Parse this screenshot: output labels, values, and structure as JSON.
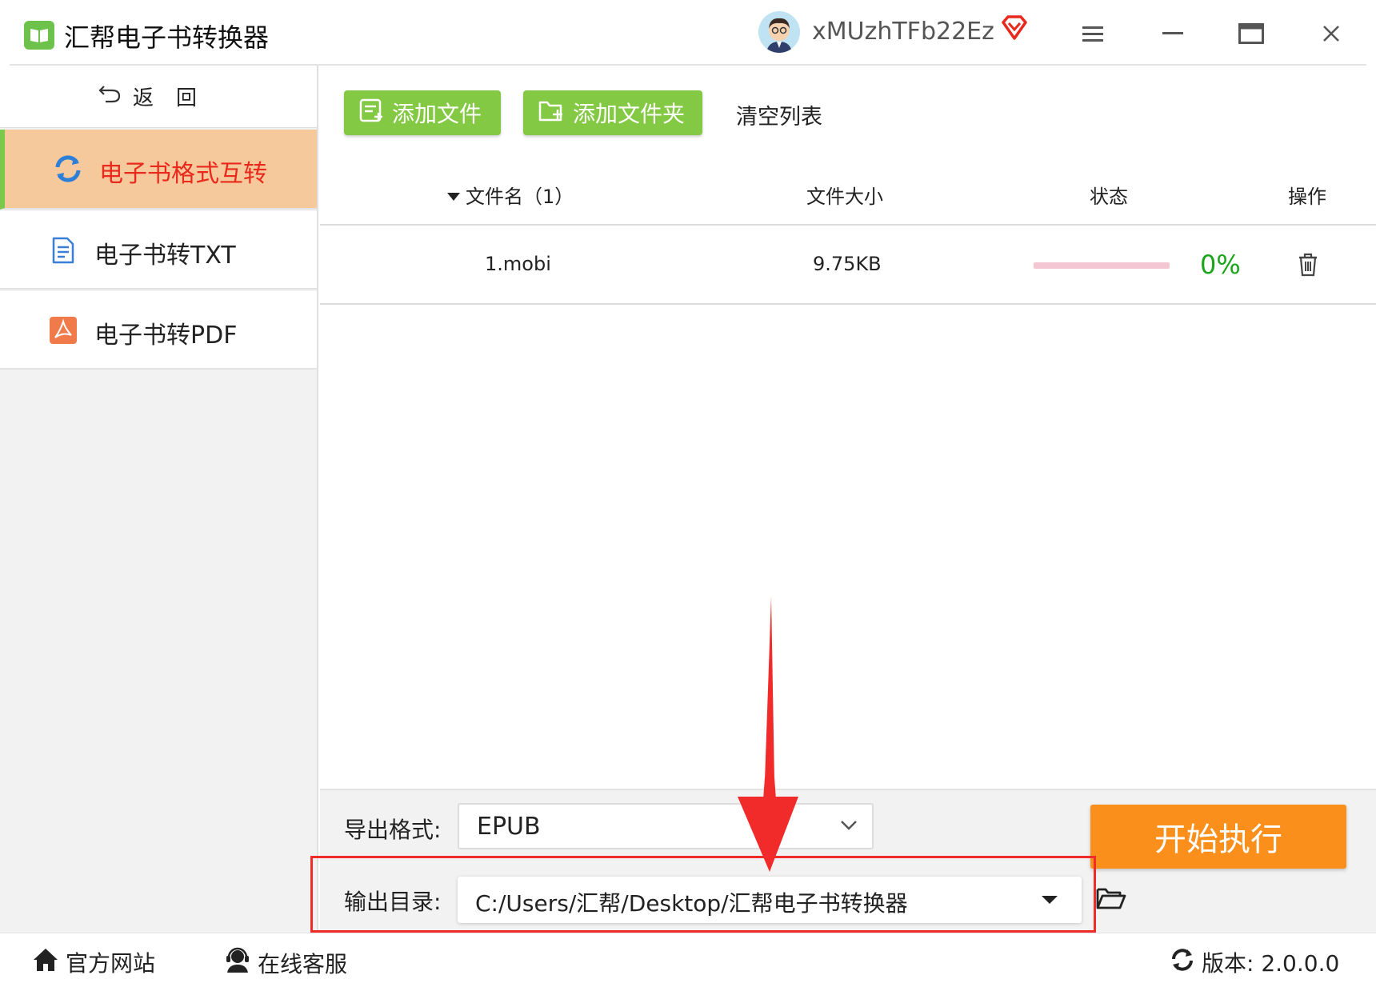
{
  "app": {
    "title": "汇帮电子书转换器",
    "username": "xMUzhTFb22Ez"
  },
  "sidebar": {
    "back_label": "返回",
    "items": [
      {
        "label": "电子书格式互转",
        "icon": "refresh-icon",
        "active": true
      },
      {
        "label": "电子书转TXT",
        "icon": "document-icon",
        "active": false
      },
      {
        "label": "电子书转PDF",
        "icon": "pdf-icon",
        "active": false
      }
    ]
  },
  "toolbar": {
    "add_file": "添加文件",
    "add_folder": "添加文件夹",
    "clear_list": "清空列表"
  },
  "table": {
    "headers": {
      "filename": "文件名（1）",
      "size": "文件大小",
      "status": "状态",
      "action": "操作"
    },
    "rows": [
      {
        "filename": "1.mobi",
        "size": "9.75KB",
        "progress": "0%",
        "progress_value": 0
      }
    ]
  },
  "settings": {
    "format_label": "导出格式:",
    "format_value": "EPUB",
    "dir_label": "输出目录:",
    "dir_value": "C:/Users/汇帮/Desktop/汇帮电子书转换器"
  },
  "start_button": "开始执行",
  "footer": {
    "website": "官方网站",
    "support": "在线客服",
    "version": "版本: 2.0.0.0"
  },
  "colors": {
    "accent_green": "#84c944",
    "active_bg": "#f6c99c",
    "active_text": "#e8291c",
    "start_orange": "#fa8f1c",
    "progress_green": "#1aa51a",
    "annotation_red": "#f12a2a"
  }
}
